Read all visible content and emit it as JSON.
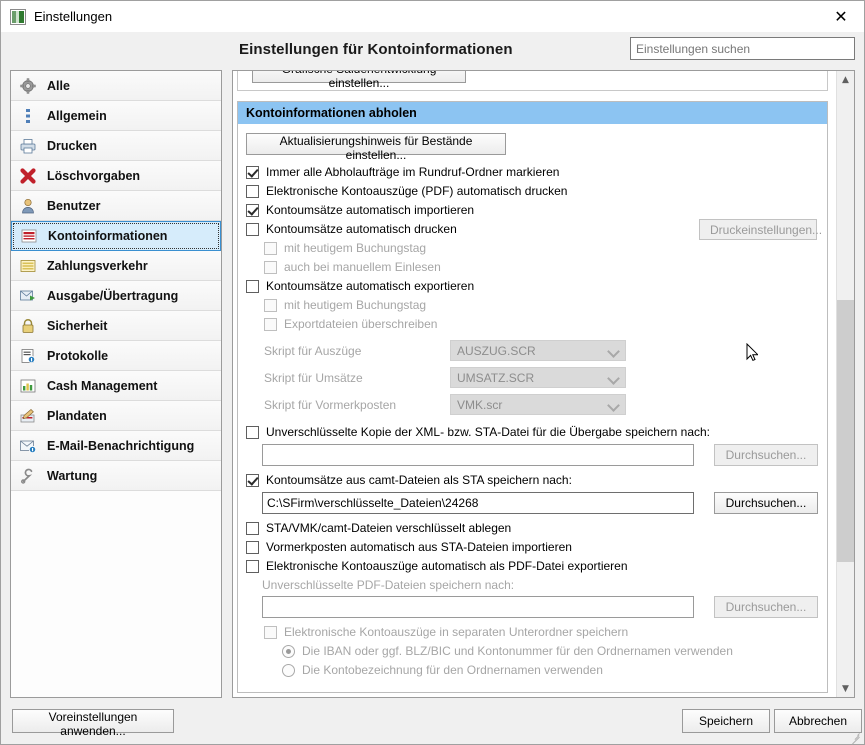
{
  "window": {
    "title": "Einstellungen",
    "icon": "app-icon",
    "close_label": "✕"
  },
  "header": {
    "title": "Einstellungen für Kontoinformationen",
    "search_placeholder": "Einstellungen suchen",
    "search_value": ""
  },
  "sidebar": {
    "items": [
      {
        "label": "Alle",
        "icon": "gear-icon",
        "selected": false
      },
      {
        "label": "Allgemein",
        "icon": "list-icon",
        "selected": false
      },
      {
        "label": "Drucken",
        "icon": "printer-icon",
        "selected": false
      },
      {
        "label": "Löschvorgaben",
        "icon": "red-x-icon",
        "selected": false
      },
      {
        "label": "Benutzer",
        "icon": "user-icon",
        "selected": false
      },
      {
        "label": "Kontoinformationen",
        "icon": "document-red-icon",
        "selected": true
      },
      {
        "label": "Zahlungsverkehr",
        "icon": "form-yellow-icon",
        "selected": false
      },
      {
        "label": "Ausgabe/Übertragung",
        "icon": "export-icon",
        "selected": false
      },
      {
        "label": "Sicherheit",
        "icon": "lock-icon",
        "selected": false
      },
      {
        "label": "Protokolle",
        "icon": "log-icon",
        "selected": false
      },
      {
        "label": "Cash Management",
        "icon": "chart-icon",
        "selected": false
      },
      {
        "label": "Plandaten",
        "icon": "pencil-icon",
        "selected": false
      },
      {
        "label": "E-Mail-Benachrichtigung",
        "icon": "mail-icon",
        "selected": false
      },
      {
        "label": "Wartung",
        "icon": "wrench-icon",
        "selected": false
      }
    ]
  },
  "content": {
    "clipped_button": "Grafische Saldenentwicklung einstellen...",
    "group_title": "Kontoinformationen abholen",
    "update_hint_button": "Aktualisierungshinweis für Bestände einstellen...",
    "checkboxes": {
      "mark_all_pickup": {
        "label": "Immer alle Abholaufträge im Rundruf-Ordner markieren",
        "checked": true,
        "enabled": true
      },
      "print_pdf_statements": {
        "label": "Elektronische Kontoauszüge (PDF) automatisch drucken",
        "checked": false,
        "enabled": true
      },
      "import_turnovers": {
        "label": "Kontoumsätze automatisch importieren",
        "checked": true,
        "enabled": true
      },
      "print_turnovers": {
        "label": "Kontoumsätze automatisch drucken",
        "checked": false,
        "enabled": true
      },
      "print_today_booking": {
        "label": "mit heutigem Buchungstag",
        "checked": false,
        "enabled": false
      },
      "print_manual_read": {
        "label": "auch bei manuellem Einlesen",
        "checked": false,
        "enabled": false
      },
      "export_turnovers": {
        "label": "Kontoumsätze automatisch exportieren",
        "checked": false,
        "enabled": true
      },
      "export_today_booking": {
        "label": "mit heutigem Buchungstag",
        "checked": false,
        "enabled": false
      },
      "overwrite_export_files": {
        "label": "Exportdateien überschreiben",
        "checked": false,
        "enabled": false
      },
      "unencrypted_copy": {
        "label": "Unverschlüsselte Kopie der XML- bzw. STA-Datei für die Übergabe speichern nach:",
        "checked": false,
        "enabled": true
      },
      "camt_as_sta": {
        "label": "Kontoumsätze aus camt-Dateien als STA speichern nach:",
        "checked": true,
        "enabled": true
      },
      "store_encrypted": {
        "label": "STA/VMK/camt-Dateien verschlüsselt ablegen",
        "checked": false,
        "enabled": true
      },
      "import_vormerkposten": {
        "label": "Vormerkposten automatisch aus STA-Dateien importieren",
        "checked": false,
        "enabled": true
      },
      "export_pdf": {
        "label": "Elektronische Kontoauszüge automatisch als PDF-Datei exportieren",
        "checked": false,
        "enabled": true
      },
      "separate_subfolder": {
        "label": "Elektronische Kontoauszüge in separaten Unterordner speichern",
        "checked": false,
        "enabled": false
      }
    },
    "print_settings_button": "Druckeinstellungen...",
    "combos": [
      {
        "label": "Skript für Auszüge",
        "value": "AUSZUG.SCR",
        "enabled": false
      },
      {
        "label": "Skript für Umsätze",
        "value": "UMSATZ.SCR",
        "enabled": false
      },
      {
        "label": "Skript für Vormerkposten",
        "value": "VMK.scr",
        "enabled": false
      }
    ],
    "paths": {
      "unencrypted_copy_value": "",
      "camt_sta_value": "C:\\SFirm\\verschlüsselte_Dateien\\24268",
      "pdf_value": ""
    },
    "browse_button": "Durchsuchen...",
    "pdf_section_label": "Unverschlüsselte PDF-Dateien speichern nach:",
    "radios": [
      {
        "label": "Die IBAN oder ggf. BLZ/BIC und Kontonummer für den Ordnernamen verwenden",
        "selected": true
      },
      {
        "label": "Die Kontobezeichnung für den Ordnernamen verwenden",
        "selected": false
      }
    ]
  },
  "footer": {
    "presets_button": "Voreinstellungen anwenden...",
    "save_button": "Speichern",
    "cancel_button": "Abbrechen"
  },
  "colors": {
    "group_header": "#8cc4f2",
    "selection": "#d6ecfb",
    "accent_border": "#3a8fd0"
  }
}
